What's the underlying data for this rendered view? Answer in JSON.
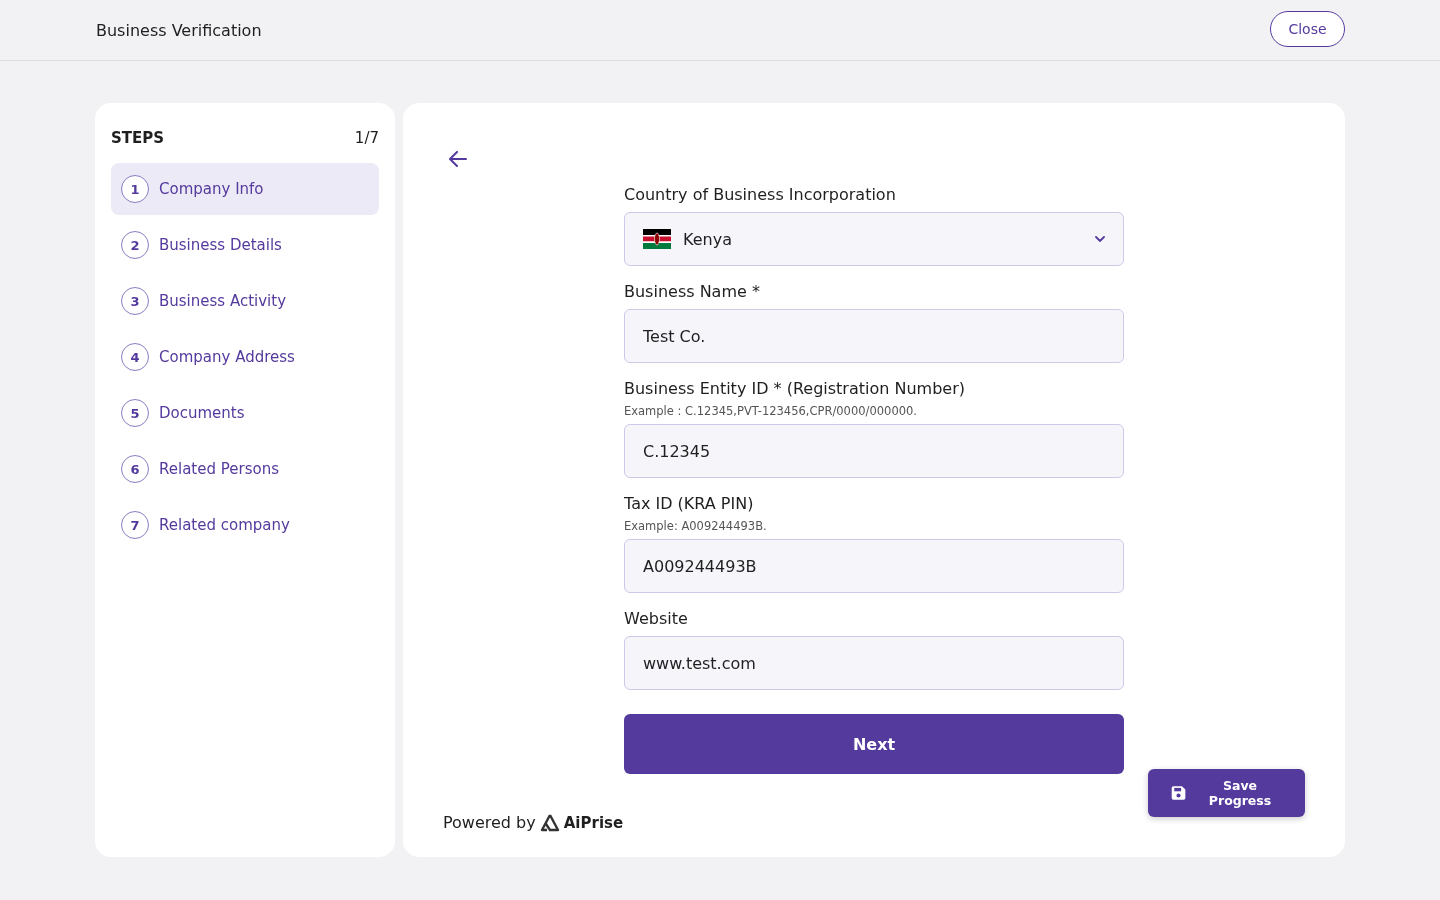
{
  "header": {
    "title": "Business Verification",
    "close_label": "Close"
  },
  "steps": {
    "title": "STEPS",
    "count": "1/7",
    "items": [
      {
        "number": "1",
        "label": "Company Info",
        "selected": true
      },
      {
        "number": "2",
        "label": "Business Details",
        "selected": false
      },
      {
        "number": "3",
        "label": "Business Activity",
        "selected": false
      },
      {
        "number": "4",
        "label": "Company Address",
        "selected": false
      },
      {
        "number": "5",
        "label": "Documents",
        "selected": false
      },
      {
        "number": "6",
        "label": "Related Persons",
        "selected": false
      },
      {
        "number": "7",
        "label": "Related company",
        "selected": false
      }
    ]
  },
  "form": {
    "fields": [
      {
        "kind": "select",
        "label": "Country of Business Incorporation",
        "value": "Kenya"
      },
      {
        "kind": "text",
        "label": "Business Name *",
        "value": "Test Co."
      },
      {
        "kind": "text",
        "label": "Business Entity ID * (Registration Number)",
        "hint": "Example : C.12345,PVT-123456,CPR/0000/000000.",
        "value": "C.12345"
      },
      {
        "kind": "text",
        "label": "Tax ID (KRA PIN)",
        "hint": "Example: A009244493B.",
        "value": "A009244493B"
      },
      {
        "kind": "text",
        "label": "Website",
        "value": "www.test.com"
      }
    ],
    "submit_label": "Next"
  },
  "footer": {
    "powered_by": "Powered by",
    "brand": "AiPrise"
  },
  "save_label": "Save Progress"
}
